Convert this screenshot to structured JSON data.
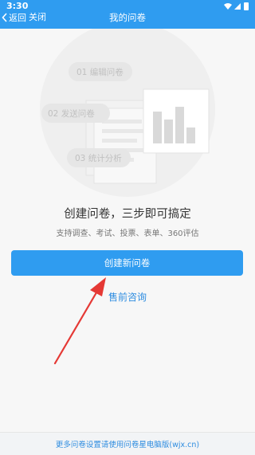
{
  "status_bar": {
    "time": "3:30",
    "icons": [
      "wifi-icon",
      "signal-icon",
      "battery-icon"
    ]
  },
  "header": {
    "back_label": "返回",
    "close_label": "关闭",
    "title": "我的问卷"
  },
  "steps": [
    {
      "label": "01  编辑问卷"
    },
    {
      "label": "02  发送问卷"
    },
    {
      "label": "03  统计分析"
    }
  ],
  "headline": "创建问卷，三步即可搞定",
  "subline": "支持调查、考试、投票、表单、360评估",
  "create_button": "创建新问卷",
  "consult_link": "售前咨询",
  "footer_link": "更多问卷设置请使用问卷星电脑版(wjx.cn)",
  "colors": {
    "primary": "#2f9cf0",
    "link": "#2f8de0",
    "annotation_arrow": "#e53935"
  }
}
